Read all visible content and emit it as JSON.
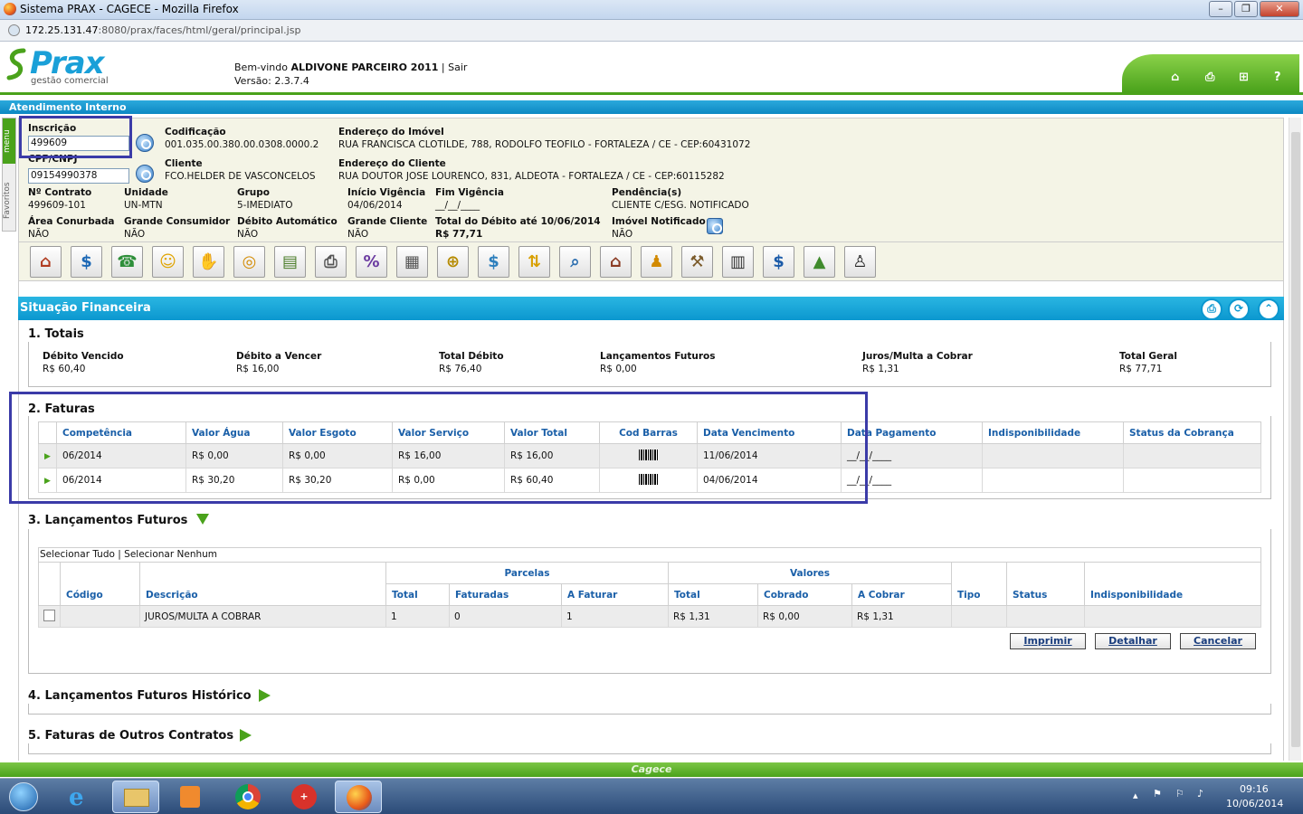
{
  "window": {
    "title": "Sistema PRAX - CAGECE - Mozilla Firefox",
    "url_host": "172.25.131.47",
    "url_rest": ":8080/prax/faces/html/geral/principal.jsp"
  },
  "header": {
    "brand": "Prax",
    "tagline": "gestão comercial",
    "welcome_prefix": "Bem-vindo ",
    "user": "ALDIVONE PARCEIRO 2011",
    "sep": " | ",
    "logout": "Sair",
    "version": "Versão: 2.3.7.4"
  },
  "header_icons": [
    "home-icon",
    "printer-icon",
    "sitemap-icon",
    "help-icon"
  ],
  "section_bar": "Atendimento Interno",
  "side": {
    "menu": "menu",
    "fav": "Favoritos"
  },
  "info": {
    "inscricao_label": "Inscrição",
    "inscricao_value": "499609",
    "cpf_label": "CPF/CNPJ",
    "cpf_value": "09154990378",
    "codificacao_label": "Codificação",
    "codificacao_value": "001.035.00.380.00.0308.0000.2",
    "endereco_imovel_label": "Endereço do Imóvel",
    "endereco_imovel_value": "RUA FRANCISCA CLOTILDE, 788, RODOLFO TEOFILO - FORTALEZA / CE - CEP:60431072",
    "cliente_label": "Cliente",
    "cliente_value": "FCO.HELDER DE VASCONCELOS",
    "endereco_cliente_label": "Endereço do Cliente",
    "endereco_cliente_value": "RUA DOUTOR JOSE LOURENCO, 831, ALDEOTA - FORTALEZA / CE - CEP:60115282",
    "contrato_label": "Nº Contrato",
    "contrato_value": "499609-101",
    "unidade_label": "Unidade",
    "unidade_value": "UN-MTN",
    "grupo_label": "Grupo",
    "grupo_value": "5-IMEDIATO",
    "inicio_label": "Início Vigência",
    "inicio_value": "04/06/2014",
    "fim_label": "Fim Vigência",
    "fim_value": "__/__/____",
    "pendencia_label": "Pendência(s)",
    "pendencia_value": "CLIENTE C/ESG. NOTIFICADO",
    "area_label": "Área Conurbada",
    "area_value": "NÃO",
    "grande_consumidor_label": "Grande Consumidor",
    "grande_consumidor_value": "NÃO",
    "debito_auto_label": "Débito Automático",
    "debito_auto_value": "NÃO",
    "grande_cliente_label": "Grande Cliente",
    "grande_cliente_value": "NÃO",
    "total_debito_label": "Total do Débito até 10/06/2014",
    "total_debito_value": "R$  77,71",
    "imovel_notificado_label": "Imóvel Notificado",
    "imovel_notificado_value": "NÃO"
  },
  "toolbar_icons": [
    "house-icon",
    "dollar-icon",
    "phone-icon",
    "smiley-headset-icon",
    "hand-money-icon",
    "coins-icon",
    "money-bills-icon",
    "cash-register-icon",
    "percent-icon",
    "document-list-icon",
    "coins-add-icon",
    "money-bag-icon",
    "transfer-arrows-icon",
    "magnifier-document-icon",
    "bank-icon",
    "people-icon",
    "auction-hammer-icon",
    "calculator-money-icon",
    "dollar-badge-icon",
    "chart-money-icon",
    "person-money-icon"
  ],
  "financeira": {
    "title": "Situação Financeira"
  },
  "totais": {
    "title": "1. Totais",
    "items": [
      {
        "label": "Débito Vencido",
        "value": "R$ 60,40"
      },
      {
        "label": "Débito a Vencer",
        "value": "R$ 16,00"
      },
      {
        "label": "Total Débito",
        "value": "R$ 76,40"
      },
      {
        "label": "Lançamentos Futuros",
        "value": "R$ 0,00"
      },
      {
        "label": "Juros/Multa a Cobrar",
        "value": "R$ 1,31"
      },
      {
        "label": "Total Geral",
        "value": "R$ 77,71"
      }
    ]
  },
  "faturas": {
    "title": "2. Faturas",
    "headers": [
      "Competência",
      "Valor Água",
      "Valor Esgoto",
      "Valor Serviço",
      "Valor Total",
      "Cod Barras",
      "Data Vencimento",
      "Data Pagamento",
      "Indisponibilidade",
      "Status da Cobrança"
    ],
    "rows": [
      [
        "06/2014",
        "R$ 0,00",
        "R$ 0,00",
        "R$ 16,00",
        "R$ 16,00",
        "",
        "11/06/2014",
        "__/__/____",
        "",
        ""
      ],
      [
        "06/2014",
        "R$ 30,20",
        "R$ 30,20",
        "R$ 0,00",
        "R$ 60,40",
        "",
        "04/06/2014",
        "__/__/____",
        "",
        ""
      ]
    ]
  },
  "lancamentos": {
    "title": "3. Lançamentos Futuros",
    "select_all": "Selecionar Tudo",
    "select_sep": " | ",
    "select_none": "Selecionar Nenhum",
    "group_parcelas": "Parcelas",
    "group_valores": "Valores",
    "headers": [
      "Código",
      "Descrição",
      "Total",
      "Faturadas",
      "A Faturar",
      "Total",
      "Cobrado",
      "A Cobrar",
      "Tipo",
      "Status",
      "Indisponibilidade"
    ],
    "rows": [
      [
        "",
        "JUROS/MULTA A COBRAR",
        "1",
        "0",
        "1",
        "R$ 1,31",
        "R$ 0,00",
        "R$ 1,31",
        "",
        "",
        ""
      ]
    ],
    "buttons": {
      "print": "Imprimir",
      "detail": "Detalhar",
      "cancel": "Cancelar"
    }
  },
  "historico": {
    "title": "4. Lançamentos Futuros Histórico"
  },
  "outros": {
    "title": "5. Faturas de Outros Contratos"
  },
  "footer": "Cagece",
  "clock": {
    "time": "09:16",
    "date": "10/06/2014"
  }
}
